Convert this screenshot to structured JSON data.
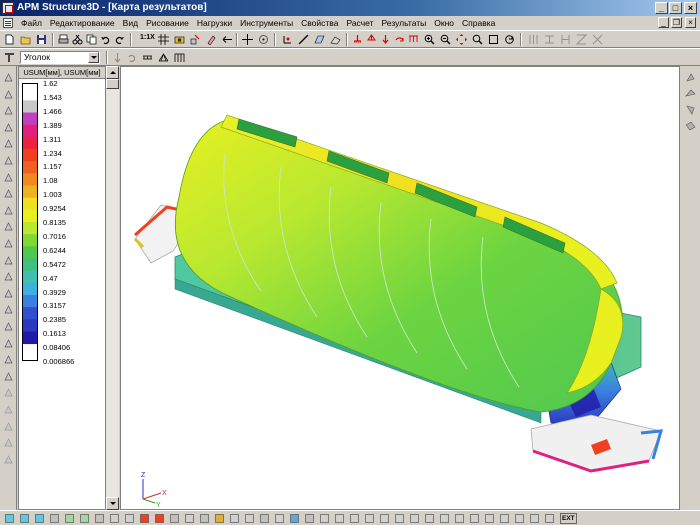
{
  "window": {
    "title": "APM Structure3D - [Карта результатов]",
    "min_label": "_",
    "max_label": "□",
    "close_label": "×"
  },
  "menu": {
    "items": [
      "Файл",
      "Редактирование",
      "Вид",
      "Рисование",
      "Нагрузки",
      "Инструменты",
      "Свойства",
      "Расчет",
      "Результаты",
      "Окно",
      "Справка"
    ]
  },
  "toolbar1": {
    "scale_label": "1:1X"
  },
  "toolbar2": {
    "combo_value": "Уголок"
  },
  "legend": {
    "header": "USUM[мм], USUM[мм]",
    "values": [
      "1.62",
      "1.543",
      "1.466",
      "1.389",
      "1.311",
      "1.234",
      "1.157",
      "1.08",
      "1.003",
      "0.9254",
      "0.8135",
      "0.7016",
      "0.6244",
      "0.5472",
      "0.47",
      "0.3929",
      "0.3157",
      "0.2385",
      "0.1613",
      "0.08406",
      "0.006866"
    ],
    "colors": [
      "#c8c8c8",
      "#c040c0",
      "#e02080",
      "#f02040",
      "#f04020",
      "#f06020",
      "#f08a20",
      "#f0b020",
      "#f0e020",
      "#e8f020",
      "#b8e830",
      "#80d830",
      "#50c850",
      "#40c080",
      "#40c0b0",
      "#40b0e0",
      "#3a80e0",
      "#3050d0",
      "#2a3ac0",
      "#201aa8"
    ]
  },
  "axes": {
    "x": "X",
    "y": "Y",
    "z": "Z"
  },
  "bottom": {
    "ext_label": "EXT"
  }
}
